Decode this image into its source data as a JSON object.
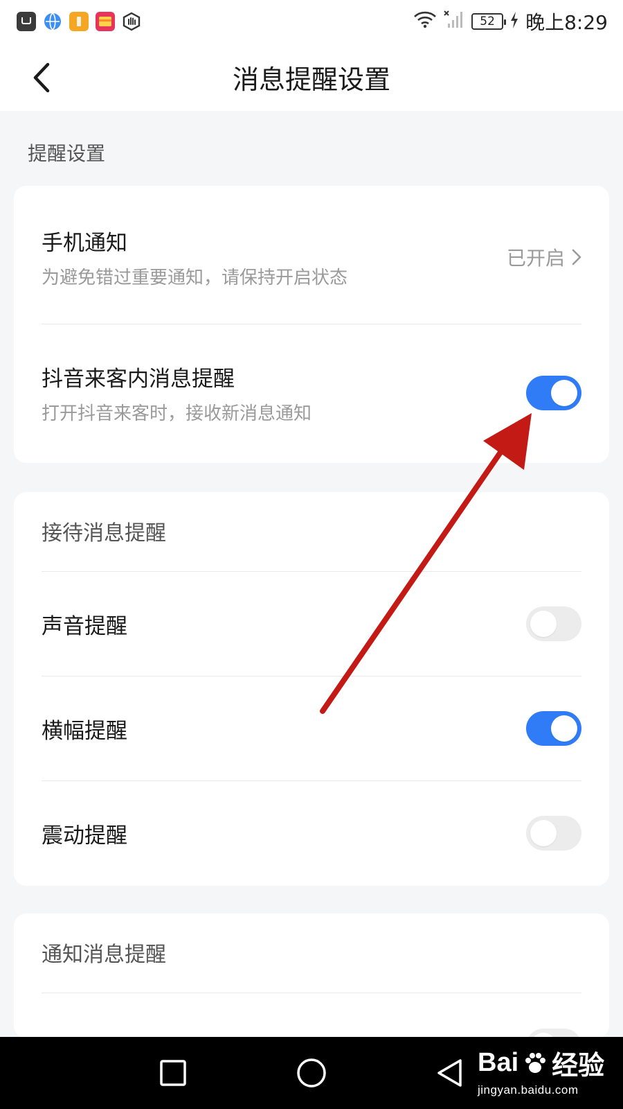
{
  "status_bar": {
    "battery_level": "52",
    "time": "晚上8:29"
  },
  "header": {
    "title": "消息提醒设置"
  },
  "section": {
    "label": "提醒设置"
  },
  "card1": {
    "phone_notification": {
      "title": "手机通知",
      "subtitle": "为避免错过重要通知，请保持开启状态",
      "value": "已开启"
    },
    "inapp_reminder": {
      "title": "抖音来客内消息提醒",
      "subtitle": "打开抖音来客时，接收新消息通知",
      "enabled": true
    }
  },
  "card2": {
    "group_title": "接待消息提醒",
    "items": [
      {
        "label": "声音提醒",
        "enabled": false
      },
      {
        "label": "横幅提醒",
        "enabled": true
      },
      {
        "label": "震动提醒",
        "enabled": false
      }
    ]
  },
  "card3": {
    "group_title": "通知消息提醒"
  },
  "watermark": {
    "brand": "Bai",
    "brand_suffix": "经验",
    "url": "jingyan.baidu.com"
  },
  "colors": {
    "accent": "#2f7cf6",
    "toggle_off": "#ececec",
    "annotation_arrow": "#c41a16"
  }
}
